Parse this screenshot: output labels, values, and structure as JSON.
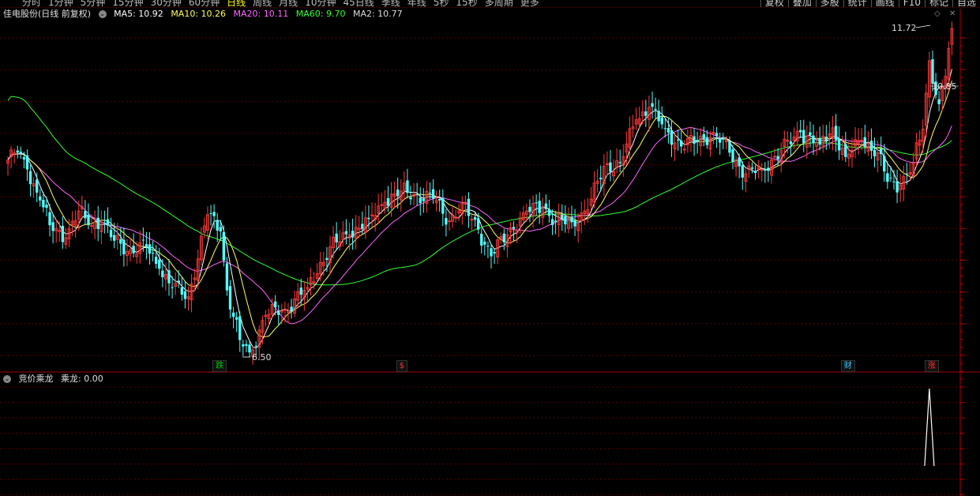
{
  "toolbar": {
    "periods": [
      {
        "label": "分时",
        "active": false
      },
      {
        "label": "1分钟",
        "active": false
      },
      {
        "label": "5分钟",
        "active": false
      },
      {
        "label": "15分钟",
        "active": false
      },
      {
        "label": "30分钟",
        "active": false
      },
      {
        "label": "60分钟",
        "active": false
      },
      {
        "label": "日线",
        "active": true
      },
      {
        "label": "周线",
        "active": false
      },
      {
        "label": "月线",
        "active": false
      },
      {
        "label": "10分钟",
        "active": false
      },
      {
        "label": "45日线",
        "active": false
      },
      {
        "label": "季线",
        "active": false
      },
      {
        "label": "年线",
        "active": false
      },
      {
        "label": "5秒",
        "active": false
      },
      {
        "label": "15秒",
        "active": false
      },
      {
        "label": "多周期",
        "active": false
      },
      {
        "label": "更多",
        "active": false
      }
    ],
    "buttons": [
      "复权",
      "叠加",
      "多股",
      "统计",
      "画线",
      "F10",
      "标记",
      "自选"
    ]
  },
  "legend": {
    "stock_label": "佳电股份(日线 前复权)",
    "ma5": "MA5: 10.92",
    "ma10": "MA10: 10.26",
    "ma20": "MA20: 10.11",
    "ma60": "MA60: 9.70",
    "ma2": "MA2: 10.77"
  },
  "indicator": {
    "name": "竞价乘龙",
    "value": "乘龙: 0.00"
  },
  "annotations": {
    "high": "11.72",
    "low": "6.50",
    "last": "10.85"
  },
  "markers": [
    {
      "label": "跌",
      "color": "#00cc00",
      "bar": 65
    },
    {
      "label": "$",
      "color": "#ff3333",
      "bar": 122
    },
    {
      "label": "财",
      "color": "#33ccff",
      "bar": 260
    },
    {
      "label": "涨",
      "color": "#ff3333",
      "bar": 286
    }
  ],
  "colors": {
    "up": "#ff3a3a",
    "down": "#54fcfc",
    "ma5": "#ffffff",
    "ma10": "#ffff66",
    "ma20": "#ff66ff",
    "ma60": "#33ff33",
    "grid": "#5a0000",
    "axis": "#aa0000",
    "signal": "#ffffff"
  },
  "chart_data": {
    "type": "candlestick",
    "ylim": [
      6.3,
      11.9
    ],
    "bars": 294,
    "signal_bar": 286,
    "signal_value": 1,
    "anchors": [
      [
        0,
        9.6
      ],
      [
        3,
        9.72
      ],
      [
        6,
        9.45
      ],
      [
        10,
        8.95
      ],
      [
        13,
        8.55
      ],
      [
        18,
        8.35
      ],
      [
        22,
        8.78
      ],
      [
        25,
        8.55
      ],
      [
        29,
        8.6
      ],
      [
        33,
        8.3
      ],
      [
        38,
        8.15
      ],
      [
        43,
        8.2
      ],
      [
        47,
        7.85
      ],
      [
        51,
        7.55
      ],
      [
        56,
        7.4
      ],
      [
        62,
        8.72
      ],
      [
        66,
        8.45
      ],
      [
        68,
        7.5
      ],
      [
        72,
        6.7
      ],
      [
        75,
        6.5
      ],
      [
        80,
        7.1
      ],
      [
        86,
        7.2
      ],
      [
        93,
        7.55
      ],
      [
        100,
        8.2
      ],
      [
        106,
        8.4
      ],
      [
        112,
        8.65
      ],
      [
        117,
        8.92
      ],
      [
        122,
        9.1
      ],
      [
        126,
        9.05
      ],
      [
        132,
        8.98
      ],
      [
        137,
        8.62
      ],
      [
        141,
        8.9
      ],
      [
        146,
        8.48
      ],
      [
        150,
        8.05
      ],
      [
        155,
        8.4
      ],
      [
        160,
        8.75
      ],
      [
        166,
        8.85
      ],
      [
        170,
        8.6
      ],
      [
        175,
        8.6
      ],
      [
        180,
        8.8
      ],
      [
        185,
        9.5
      ],
      [
        190,
        9.55
      ],
      [
        195,
        10.25
      ],
      [
        199,
        10.45
      ],
      [
        204,
        10.1
      ],
      [
        209,
        9.82
      ],
      [
        214,
        9.9
      ],
      [
        219,
        10.05
      ],
      [
        224,
        9.72
      ],
      [
        229,
        9.38
      ],
      [
        234,
        9.45
      ],
      [
        240,
        9.75
      ],
      [
        246,
        10.05
      ],
      [
        252,
        9.85
      ],
      [
        256,
        10.12
      ],
      [
        260,
        9.65
      ],
      [
        265,
        9.92
      ],
      [
        270,
        9.72
      ],
      [
        273,
        9.25
      ],
      [
        277,
        9.2
      ],
      [
        281,
        9.55
      ],
      [
        284,
        10.1
      ],
      [
        286,
        11.2
      ],
      [
        289,
        10.5
      ],
      [
        291,
        10.95
      ],
      [
        293,
        11.72
      ]
    ]
  }
}
